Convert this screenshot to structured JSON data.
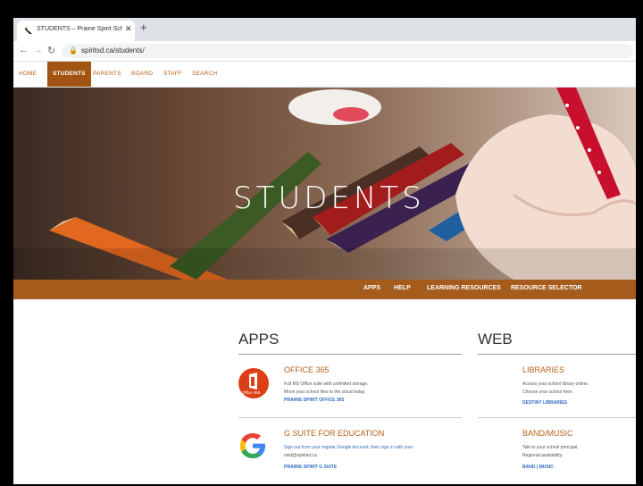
{
  "browser": {
    "tab_title": "STUDENTS – Prairie Spirit School…",
    "url": "spiritsd.ca/students/"
  },
  "site_nav": {
    "items": [
      {
        "label": "HOME"
      },
      {
        "label": "STUDENTS"
      },
      {
        "label": "PARENTS"
      },
      {
        "label": "BOARD"
      },
      {
        "label": "STAFF"
      },
      {
        "label": "SEARCH"
      }
    ],
    "active": "STUDENTS"
  },
  "hero": {
    "title": "STUDENTS"
  },
  "sub_nav": {
    "items": [
      {
        "label": "APPS"
      },
      {
        "label": "HELP"
      },
      {
        "label": "LEARNING RESOURCES"
      },
      {
        "label": "RESOURCE SELECTOR"
      }
    ]
  },
  "apps": {
    "heading": "APPS",
    "cards": [
      {
        "title": "OFFICE 365",
        "lines": [
          "Full MS Office suite with unlimited storage.",
          "Move your school files to the cloud today."
        ],
        "link": "PRAIRIE SPIRIT OFFICE 365",
        "icon_label": "Office 365"
      },
      {
        "title": "G SUITE FOR EDUCATION",
        "lines": [
          "Sign out from your regular Google Account, then sign in with your",
          "nsid@spiritsd.ca"
        ],
        "link": "PRAIRIE SPIRIT G SUITE"
      }
    ]
  },
  "web": {
    "heading": "WEB",
    "cards": [
      {
        "title": "LIBRARIES",
        "lines": [
          "Access your school library online.",
          "Choose your school here."
        ],
        "link": "DESTINY LIBRARIES"
      },
      {
        "title": "BAND/MUSIC",
        "lines": [
          "Talk to your school principal.",
          "Regional availability."
        ],
        "link": "BAND | MUSIC"
      }
    ]
  },
  "colors": {
    "brand_orange": "#a65c1c",
    "link_blue": "#2f6bbf",
    "office_red": "#dc3e15"
  }
}
